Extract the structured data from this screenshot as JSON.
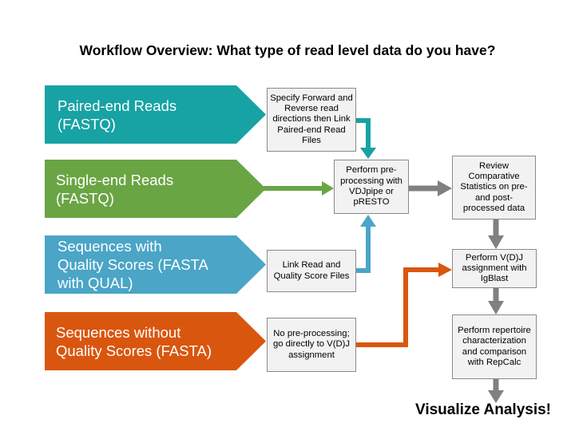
{
  "title": "Workflow Overview: What type of read level data do you have?",
  "inputs": [
    {
      "label_line1": "Paired-end Reads",
      "label_line2": "(FASTQ)",
      "color": "#17a2a4"
    },
    {
      "label_line1": "Single-end Reads",
      "label_line2": "(FASTQ)",
      "color": "#6aa544"
    },
    {
      "label_line1": "Sequences with",
      "label_line2": "Quality Scores (FASTA",
      "label_line3": "with QUAL)",
      "color": "#4aa5c7"
    },
    {
      "label_line1": "Sequences without",
      "label_line2": "Quality Scores (FASTA)",
      "color": "#d9560f"
    }
  ],
  "steps": {
    "specify_directions": "Specify Forward and Reverse read directions then Link Paired-end Read Files",
    "link_quality": "Link Read and Quality Score Files",
    "no_preprocessing": "No pre-processing; go directly to V(D)J assignment",
    "preprocess": "Perform pre-processing with VDJpipe or pRESTO",
    "review_stats": "Review Comparative Statistics on pre- and post-processed data",
    "vdj_assign": "Perform V(D)J assignment with IgBlast",
    "repertoire": "Perform repertoire characterization and comparison with RepCalc"
  },
  "final_label": "Visualize Analysis!",
  "connector_colors": {
    "gray": "#808080"
  }
}
